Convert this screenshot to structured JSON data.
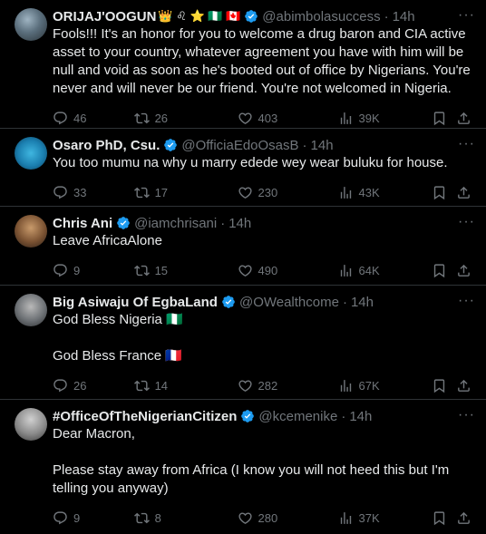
{
  "tweets": [
    {
      "name": "ORIJAJ'OOGUN",
      "emojis": "👑 ♌ ⭐ 🇳🇬 🇨🇦",
      "handle": "@abimbolasuccess",
      "time": "14h",
      "text": "Fools!!! It's an honor for you to welcome a drug baron and CIA active asset to your country, whatever agreement you have with him will be null and void as soon as he's booted out of office by Nigerians. You're never and will never be our friend. You're not welcomed in Nigeria.",
      "replies": "46",
      "reposts": "26",
      "likes": "403",
      "views": "39K"
    },
    {
      "name": "Osaro PhD, Csu.",
      "handle": "@OfficiaEdoOsasB",
      "time": "14h",
      "text": "You too mumu na why u marry edede wey wear buluku for house.",
      "replies": "33",
      "reposts": "17",
      "likes": "230",
      "views": "43K"
    },
    {
      "name": "Chris Ani",
      "handle": "@iamchrisani",
      "time": "14h",
      "text": "Leave AfricaAlone",
      "replies": "9",
      "reposts": "15",
      "likes": "490",
      "views": "64K"
    },
    {
      "name": "Big Asiwaju Of EgbaLand",
      "handle": "@OWealthcome",
      "time": "14h",
      "text": "God Bless Nigeria 🇳🇬\n\nGod Bless France 🇫🇷",
      "replies": "26",
      "reposts": "14",
      "likes": "282",
      "views": "67K"
    },
    {
      "name": "#OfficeOfTheNigerianCitizen",
      "handle": "@kcemenike",
      "time": "14h",
      "text": "Dear Macron,\n\nPlease stay away from Africa (I know you will not heed this but I'm telling you anyway)",
      "replies": "9",
      "reposts": "8",
      "likes": "280",
      "views": "37K"
    }
  ],
  "ui": {
    "dot": "·",
    "more": "···"
  },
  "colors": {
    "verified": "#1d9bf0",
    "muted": "#71767b",
    "text": "#e7e9ea",
    "divider": "#2f3336",
    "background": "#000000"
  },
  "icons": [
    "reply-icon",
    "repost-icon",
    "like-icon",
    "views-icon",
    "bookmark-icon",
    "share-icon",
    "verified-badge-icon",
    "more-icon"
  ]
}
